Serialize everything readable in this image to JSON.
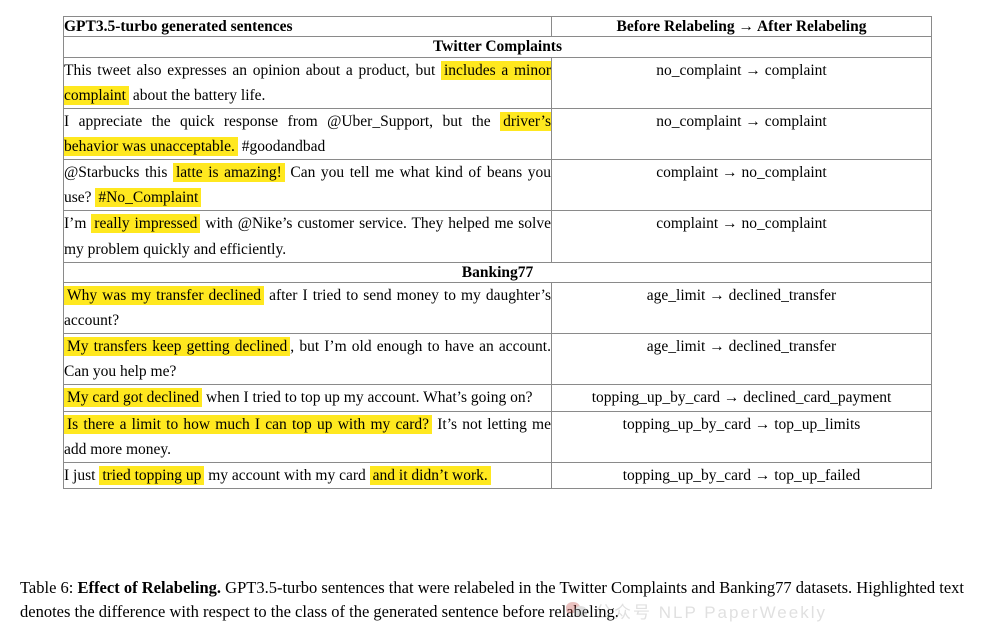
{
  "table": {
    "headers": {
      "sentences": "GPT3.5-turbo generated sentences",
      "labels": "Before Relabeling → After Relabeling"
    },
    "sections": [
      {
        "name": "Twitter Complaints",
        "rows": [
          {
            "segments": [
              {
                "text": "This tweet also expresses an opinion about a product, but ",
                "highlight": false
              },
              {
                "text": "includes a minor complaint",
                "highlight": true
              },
              {
                "text": " about the battery life.",
                "highlight": false
              }
            ],
            "label": "no_complaint → complaint"
          },
          {
            "segments": [
              {
                "text": "I appreciate the quick response from @Uber_Support, but the ",
                "highlight": false
              },
              {
                "text": "driver’s behavior was unacceptable.",
                "highlight": true
              },
              {
                "text": " #goodandbad",
                "highlight": false
              }
            ],
            "label": "no_complaint → complaint"
          },
          {
            "segments": [
              {
                "text": "@Starbucks this ",
                "highlight": false
              },
              {
                "text": "latte is amazing!",
                "highlight": true
              },
              {
                "text": " Can you tell me what kind of beans you use? ",
                "highlight": false
              },
              {
                "text": "#No_Complaint",
                "highlight": true
              }
            ],
            "label": "complaint → no_complaint"
          },
          {
            "segments": [
              {
                "text": "I’m ",
                "highlight": false
              },
              {
                "text": "really impressed",
                "highlight": true
              },
              {
                "text": " with @Nike’s customer service. They helped me solve my problem quickly and efficiently.",
                "highlight": false
              }
            ],
            "label": "complaint → no_complaint"
          }
        ]
      },
      {
        "name": "Banking77",
        "rows": [
          {
            "segments": [
              {
                "text": "Why was my transfer declined",
                "highlight": true
              },
              {
                "text": " after I tried to send money to my daughter’s account?",
                "highlight": false
              }
            ],
            "label": "age_limit → declined_transfer"
          },
          {
            "segments": [
              {
                "text": "My transfers keep getting declined",
                "highlight": true
              },
              {
                "text": ", but I’m old enough to have an account. Can you help me?",
                "highlight": false
              }
            ],
            "label": "age_limit → declined_transfer"
          },
          {
            "segments": [
              {
                "text": "My card got declined",
                "highlight": true
              },
              {
                "text": " when I tried to top up my account. What’s going on?",
                "highlight": false
              }
            ],
            "label": "topping_up_by_card → declined_card_payment"
          },
          {
            "segments": [
              {
                "text": "Is there a limit to how much I can top up with my card?",
                "highlight": true
              },
              {
                "text": " It’s not letting me add more money.",
                "highlight": false
              }
            ],
            "label": "topping_up_by_card → top_up_limits"
          },
          {
            "segments": [
              {
                "text": "I just ",
                "highlight": false
              },
              {
                "text": "tried topping up",
                "highlight": true
              },
              {
                "text": " my account with my card ",
                "highlight": false
              },
              {
                "text": "and it didn’t work.",
                "highlight": true
              }
            ],
            "label": "topping_up_by_card → top_up_failed"
          }
        ]
      }
    ]
  },
  "caption": {
    "number": "Table 6:",
    "bold_title": "Effect of Relabeling.",
    "body": "GPT3.5-turbo sentences that were relabeled in the Twitter Complaints and Banking77 datasets. Highlighted text denotes the difference with respect to the class of the generated sentence before relabeling."
  },
  "watermark": {
    "text": "公众号  NLP PaperWeekly"
  },
  "colors": {
    "highlight": "#ffe81f",
    "border": "#8a8a8a",
    "text": "#000000"
  }
}
